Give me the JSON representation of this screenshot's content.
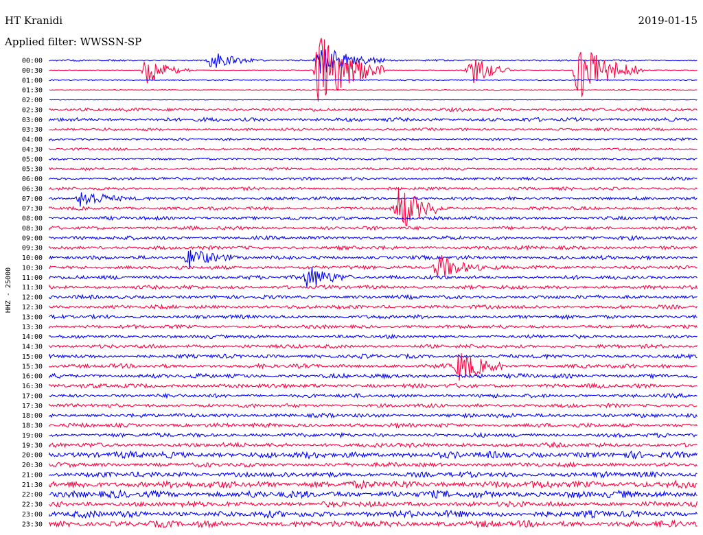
{
  "chart_data": {
    "type": "line",
    "subtype": "helicorder",
    "station": "HT Kranidi",
    "date": "2019-01-15",
    "filter_label": "Applied filter: WWSSN-SP",
    "ylabel": "HHZ - 25000",
    "row_minutes": 30,
    "colors": [
      "#0000ff",
      "#ff0040"
    ],
    "rows": [
      "00:00",
      "00:30",
      "01:00",
      "01:30",
      "02:00",
      "02:30",
      "03:00",
      "03:30",
      "04:00",
      "04:30",
      "05:00",
      "05:30",
      "06:00",
      "06:30",
      "07:00",
      "07:30",
      "08:00",
      "08:30",
      "09:00",
      "09:30",
      "10:00",
      "10:30",
      "11:00",
      "11:30",
      "12:00",
      "12:30",
      "13:00",
      "13:30",
      "14:00",
      "14:30",
      "15:00",
      "15:30",
      "16:00",
      "16:30",
      "17:00",
      "17:30",
      "18:00",
      "18:30",
      "19:00",
      "19:30",
      "20:00",
      "20:30",
      "21:00",
      "21:30",
      "22:00",
      "22:30",
      "23:00",
      "23:30"
    ],
    "noise_level": [
      0.6,
      0.3,
      0.5,
      0.3,
      0.2,
      1.2,
      1.4,
      1.0,
      0.9,
      0.9,
      0.9,
      1.0,
      1.1,
      1.1,
      1.2,
      1.2,
      1.3,
      1.3,
      1.4,
      1.4,
      1.4,
      1.4,
      1.4,
      1.4,
      1.4,
      1.4,
      1.4,
      1.3,
      1.3,
      1.4,
      1.5,
      1.5,
      1.6,
      1.6,
      1.4,
      1.4,
      1.5,
      1.5,
      1.5,
      1.7,
      2.4,
      1.6,
      2.0,
      2.7,
      2.6,
      2.0,
      2.4,
      2.4
    ],
    "events": [
      {
        "row": 0,
        "minute": 7.5,
        "amplitude": 1.8,
        "duration_min": 2
      },
      {
        "row": 1,
        "minute": 4.5,
        "amplitude": 2.5,
        "duration_min": 2
      },
      {
        "row": 0,
        "minute": 12.5,
        "amplitude": 2.8,
        "duration_min": 3
      },
      {
        "row": 1,
        "minute": 12.5,
        "amplitude": 7.0,
        "duration_min": 3
      },
      {
        "row": 1,
        "minute": 19.5,
        "amplitude": 3.0,
        "duration_min": 2
      },
      {
        "row": 1,
        "minute": 24.5,
        "amplitude": 5.5,
        "duration_min": 3
      },
      {
        "row": 15,
        "minute": 16.2,
        "amplitude": 4.5,
        "duration_min": 2
      },
      {
        "row": 20,
        "minute": 6.5,
        "amplitude": 2.0,
        "duration_min": 2
      },
      {
        "row": 21,
        "minute": 18.0,
        "amplitude": 2.5,
        "duration_min": 2
      },
      {
        "row": 22,
        "minute": 12.0,
        "amplitude": 2.2,
        "duration_min": 2
      },
      {
        "row": 31,
        "minute": 19.0,
        "amplitude": 3.0,
        "duration_min": 2
      },
      {
        "row": 14,
        "minute": 1.5,
        "amplitude": 1.8,
        "duration_min": 2
      }
    ]
  }
}
